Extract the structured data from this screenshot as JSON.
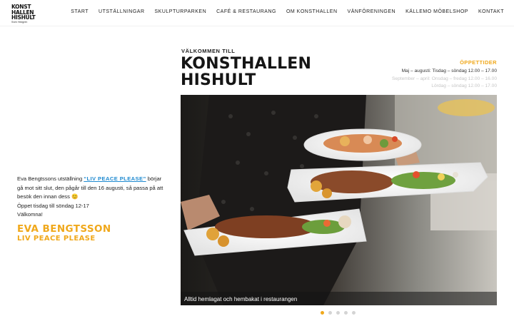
{
  "logo": {
    "lines": [
      "KONST",
      "HALLEN",
      "HISHULT"
    ],
    "subtitle": "Sven Hedgren"
  },
  "nav": [
    {
      "label": "START"
    },
    {
      "label": "UTSTÄLLNINGAR"
    },
    {
      "label": "SKULPTURPARKEN"
    },
    {
      "label": "CAFÉ & RESTAURANG"
    },
    {
      "label": "OM KONSTHALLEN"
    },
    {
      "label": "VÄNFÖRENINGEN"
    },
    {
      "label": "KÄLLEMO MÖBELSHOP"
    },
    {
      "label": "KONTAKT"
    }
  ],
  "welcome": {
    "kicker": "VÄLKOMMEN TILL",
    "title_line1": "KONSTHALLEN",
    "title_line2": "HISHULT"
  },
  "hours": {
    "title": "ÖPPETTIDER",
    "lines": [
      "Maj – augusti: Tisdag – söndag 12.00 – 17.00",
      "September – april: Onsdag – fredag 12.00 – 16.00",
      "Lördag – söndag 12.00 – 17.00"
    ]
  },
  "intro": {
    "text_before": "Eva Bengtssons utställning ",
    "link": "“LIV PEACE PLEASE”",
    "text_after": " börjar gå mot sitt slut, den pågår till den 16 augusti, så passa på att besök den innan dess 😊",
    "line2": "Öppet tisdag till söndag 12-17",
    "line3": "Välkomna!"
  },
  "artist": {
    "name": "EVA BENGTSSON",
    "show": "LIV PEACE PLEASE"
  },
  "slider": {
    "caption": "Alltid hemlagat och hembakat i restaurangen",
    "slide_count": 5,
    "active_index": 0
  },
  "colors": {
    "accent": "#f0a81b",
    "link": "#1f8ad0"
  }
}
